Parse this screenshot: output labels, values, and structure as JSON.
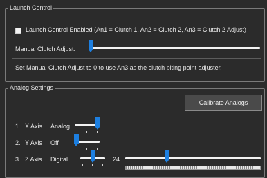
{
  "launch_control": {
    "group_title": "Launch Control",
    "checkbox_label": "Launch Control Enabled (An1 = Clutch 1, An2 = Clutch 2, An3 = Clutch 2 Adjust)",
    "checkbox_checked": false,
    "manual_clutch_label": "Manual Clutch Adjust.",
    "manual_clutch_fraction": 0.0,
    "hint": "Set Manual Clutch Adjust to 0 to use An3 as the clutch biting point adjuster."
  },
  "analog_settings": {
    "group_title": "Analog Settings",
    "calibrate_label": "Calibrate Analogs",
    "axes": [
      {
        "index": "1.",
        "name": "X Axis",
        "mode": "Analog",
        "mode_level": 1.0
      },
      {
        "index": "2.",
        "name": "Y Axis",
        "mode": "Off",
        "mode_level": 0.0
      },
      {
        "index": "3.",
        "name": "Z Axis",
        "mode": "Digital",
        "mode_level": 0.5,
        "value": "24",
        "value_fraction": 0.3
      }
    ]
  },
  "colors": {
    "background": "#2b2b2b",
    "accent": "#1d7fe0",
    "border": "#7a7a7a"
  }
}
